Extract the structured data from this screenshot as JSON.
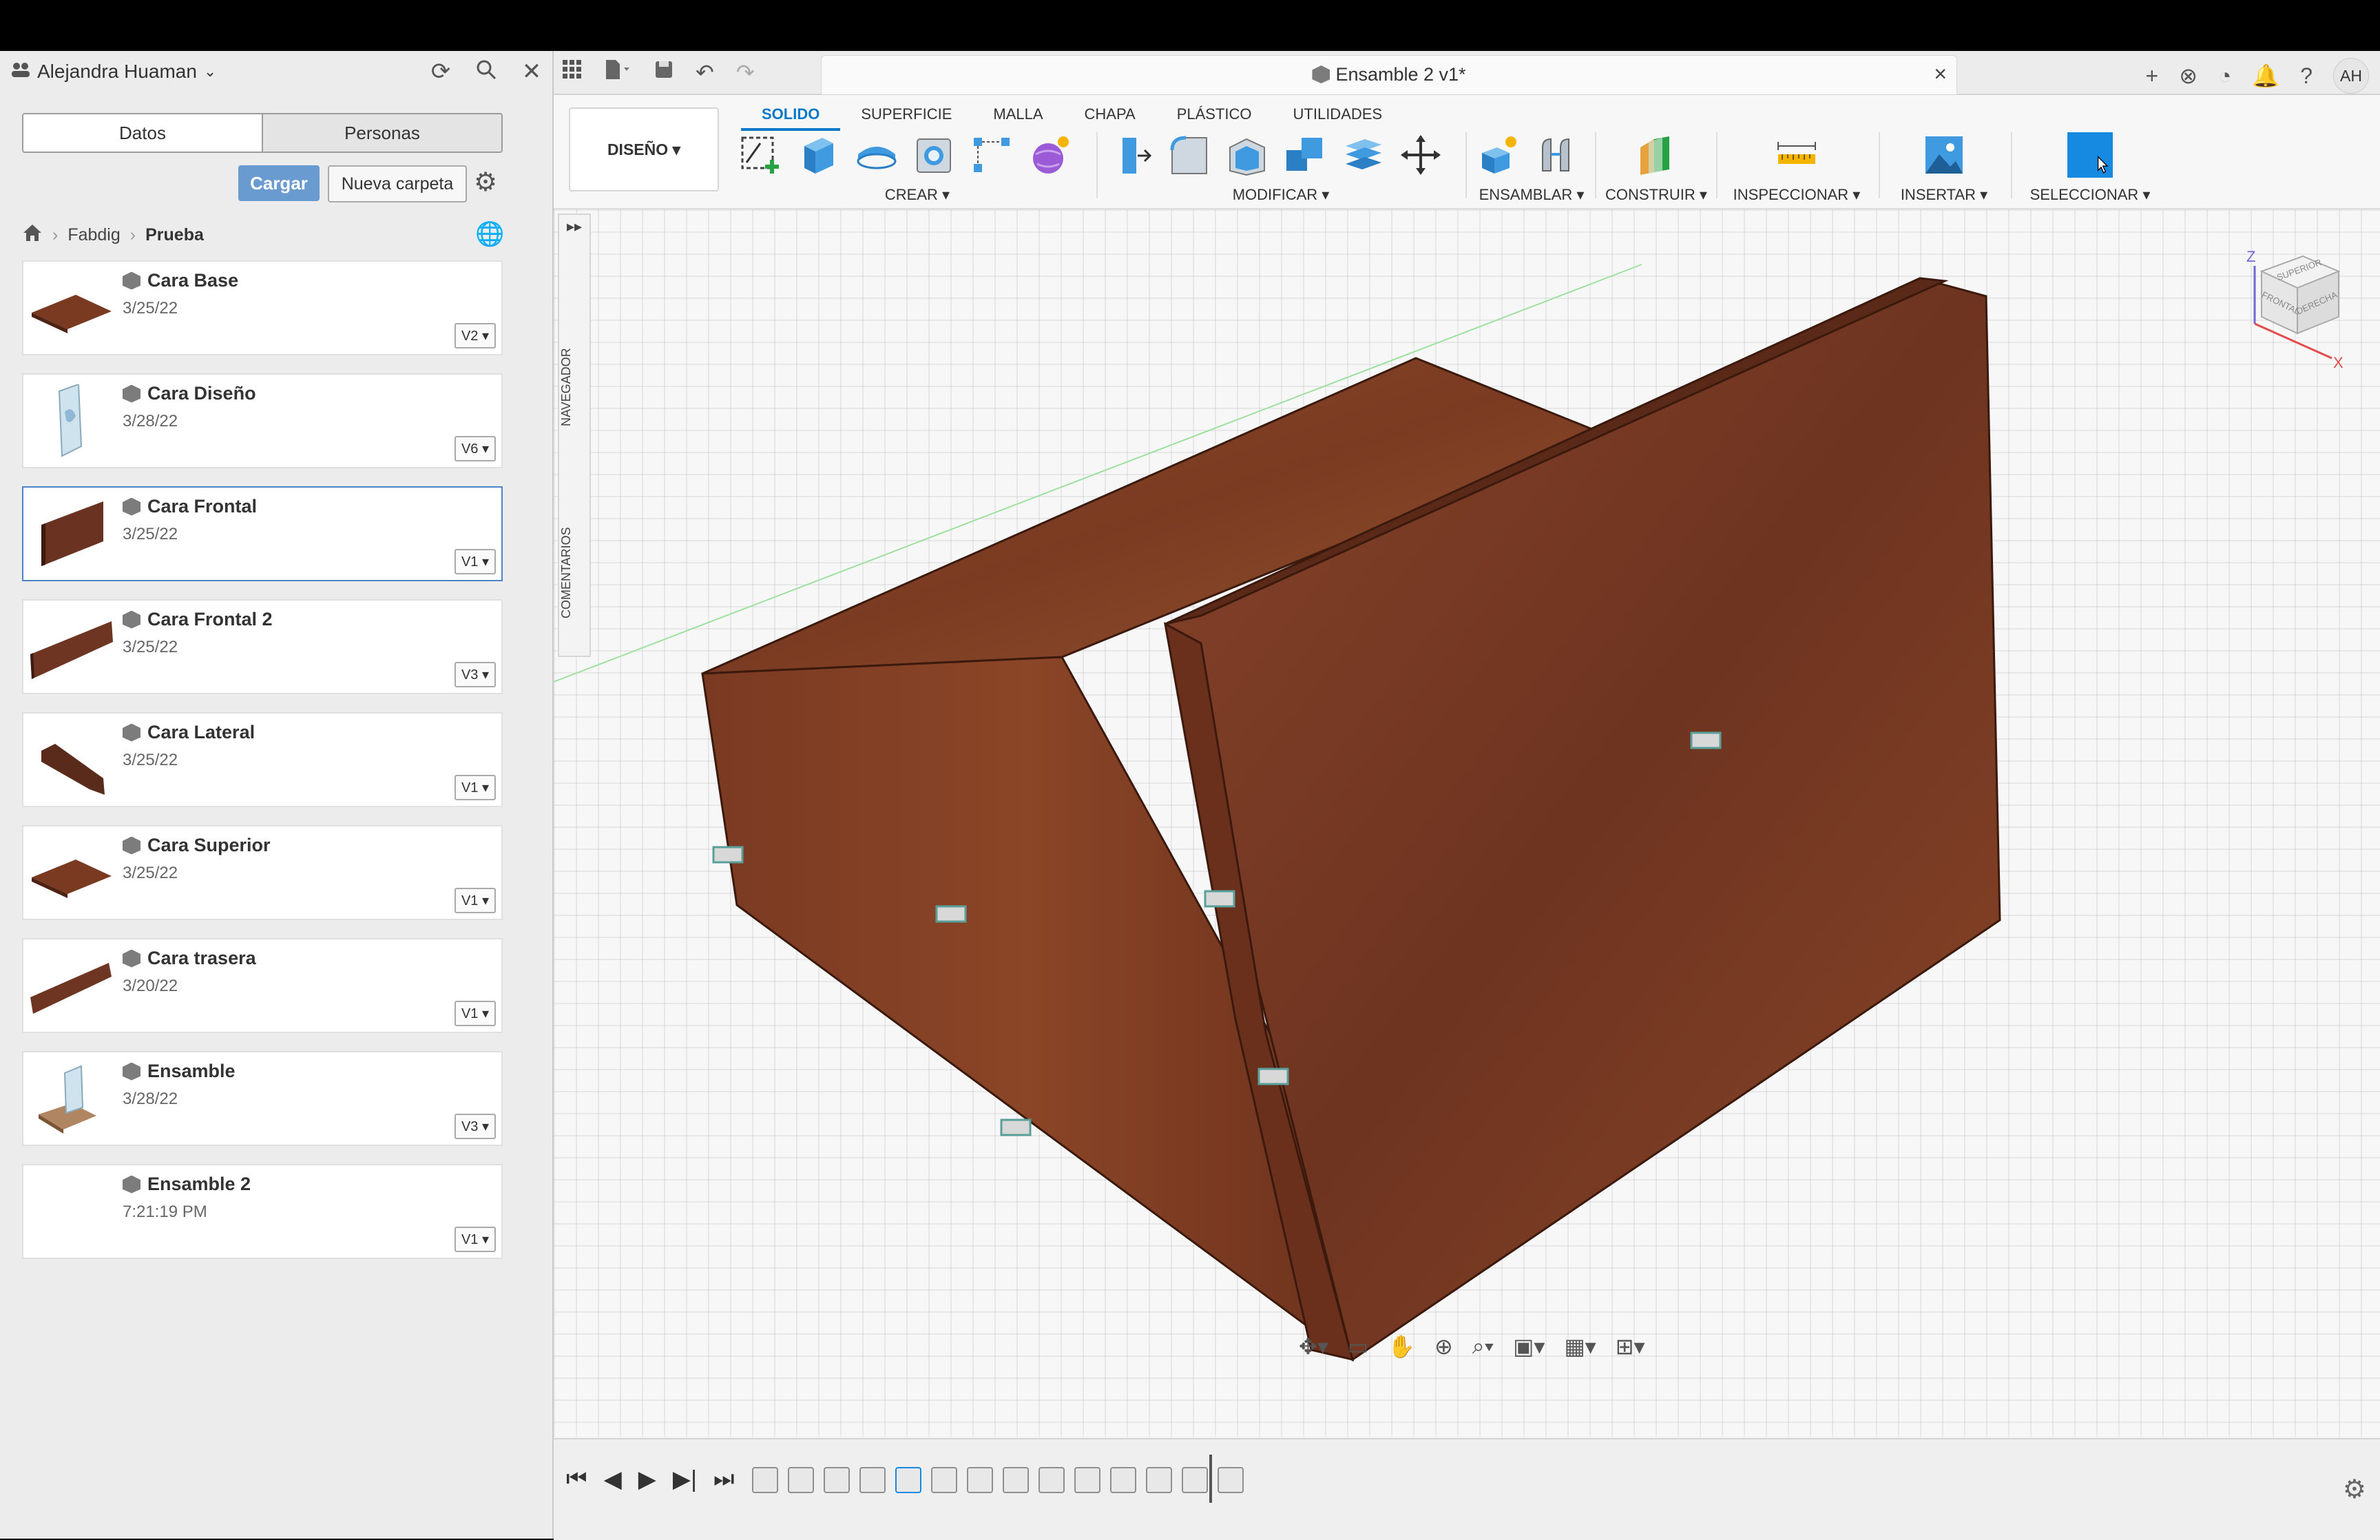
{
  "user": {
    "name": "Alejandra Huaman",
    "initials": "AH"
  },
  "panel_tabs": [
    "Datos",
    "Personas"
  ],
  "buttons": {
    "cargar": "Cargar",
    "nueva_carpeta": "Nueva carpeta"
  },
  "breadcrumb": [
    "Fabdig",
    "Prueba"
  ],
  "files": [
    {
      "name": "Cara Base",
      "date": "3/25/22",
      "version": "V2 ▾"
    },
    {
      "name": "Cara Diseño",
      "date": "3/28/22",
      "version": "V6 ▾"
    },
    {
      "name": "Cara Frontal",
      "date": "3/25/22",
      "version": "V1 ▾"
    },
    {
      "name": "Cara Frontal 2",
      "date": "3/25/22",
      "version": "V3 ▾"
    },
    {
      "name": "Cara Lateral",
      "date": "3/25/22",
      "version": "V1 ▾"
    },
    {
      "name": "Cara Superior",
      "date": "3/25/22",
      "version": "V1 ▾"
    },
    {
      "name": "Cara trasera",
      "date": "3/20/22",
      "version": "V1 ▾"
    },
    {
      "name": "Ensamble",
      "date": "3/28/22",
      "version": "V3 ▾"
    },
    {
      "name": "Ensamble 2",
      "date": "7:21:19 PM",
      "version": "V1 ▾"
    }
  ],
  "document_title": "Ensamble 2 v1*",
  "workspace": "DISEÑO ▾",
  "tabs": [
    "SOLIDO",
    "SUPERFICIE",
    "MALLA",
    "CHAPA",
    "PLÁSTICO",
    "UTILIDADES"
  ],
  "groups": {
    "crear": "CREAR ▾",
    "modificar": "MODIFICAR ▾",
    "ensamblar": "ENSAMBLAR ▾",
    "construir": "CONSTRUIR ▾",
    "inspeccionar": "INSPECCIONAR ▾",
    "insertar": "INSERTAR ▾",
    "seleccionar": "SELECCIONAR ▾"
  },
  "side_panels": {
    "navegador": "NAVEGADOR",
    "comentarios": "COMENTARIOS"
  },
  "viewcube": {
    "top": "SUPERIOR",
    "front": "FRONTAL",
    "right": "DERECHA",
    "axis_z": "Z",
    "axis_x": "X"
  },
  "colors": {
    "accent": "#0a77c7",
    "button": "#6a9bd0",
    "wood": "#8a4326"
  }
}
